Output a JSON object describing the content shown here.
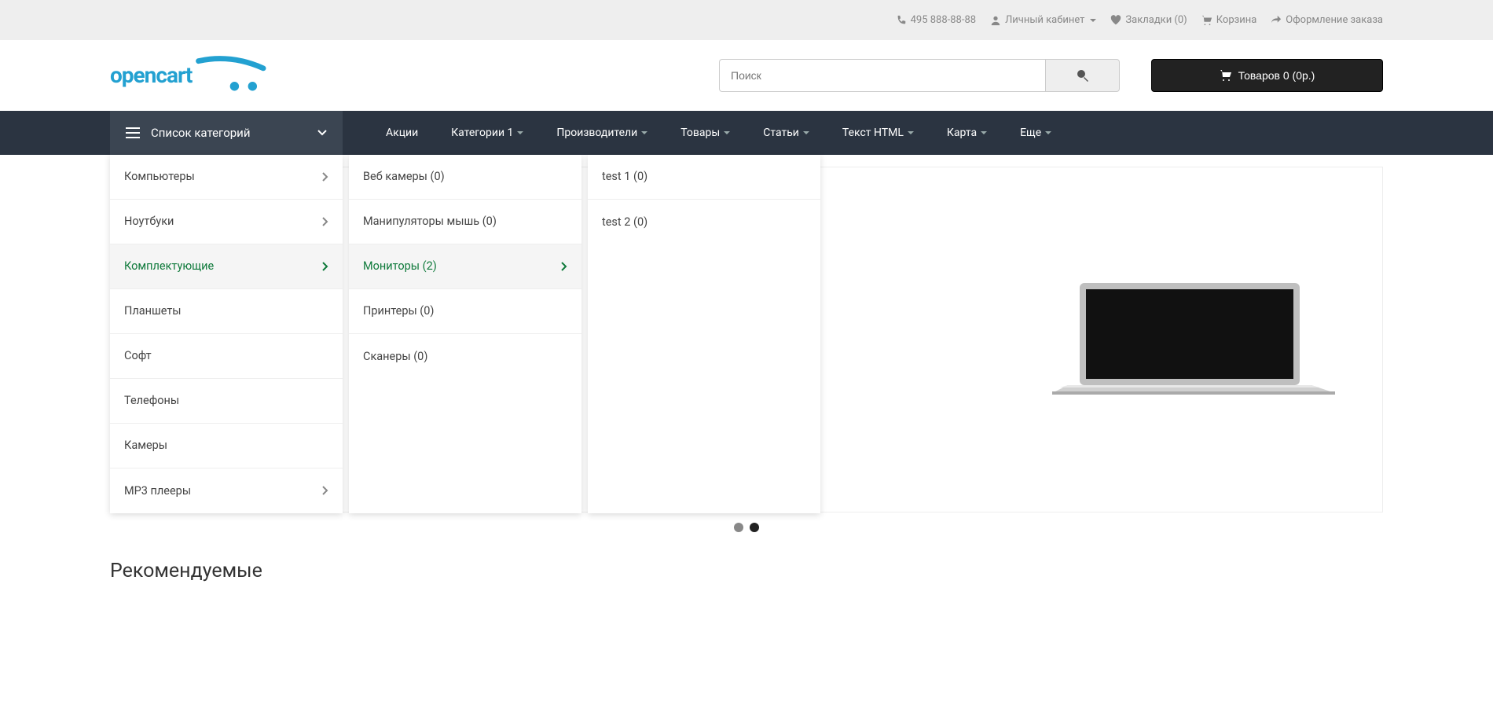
{
  "topbar": {
    "phone": "495 888-88-88",
    "account": "Личный кабинет",
    "wishlist": "Закладки (0)",
    "cart": "Корзина",
    "checkout": "Оформление заказа"
  },
  "logo": {
    "text": "opencart"
  },
  "search": {
    "placeholder": "Поиск"
  },
  "cart_button": {
    "label": "Товаров 0 (0р.)"
  },
  "catmenu": {
    "title": "Список категорий"
  },
  "nav": {
    "items": [
      "Акции",
      "Категории 1",
      "Производители",
      "Товары",
      "Статьи",
      "Текст HTML",
      "Карта",
      "Еще"
    ],
    "has_caret": [
      false,
      true,
      true,
      true,
      true,
      true,
      true,
      true
    ]
  },
  "menu_col1": [
    {
      "label": "Компьютеры",
      "arrow": true,
      "active": false
    },
    {
      "label": "Ноутбуки",
      "arrow": true,
      "active": false
    },
    {
      "label": "Комплектующие",
      "arrow": true,
      "active": true
    },
    {
      "label": "Планшеты",
      "arrow": false,
      "active": false
    },
    {
      "label": "Софт",
      "arrow": false,
      "active": false
    },
    {
      "label": "Телефоны",
      "arrow": false,
      "active": false
    },
    {
      "label": "Камеры",
      "arrow": false,
      "active": false
    },
    {
      "label": "MP3 плееры",
      "arrow": true,
      "active": false
    }
  ],
  "menu_col2": [
    {
      "label": "Веб камеры (0)",
      "arrow": false,
      "active": false
    },
    {
      "label": "Манипуляторы мышь (0)",
      "arrow": false,
      "active": false
    },
    {
      "label": "Мониторы (2)",
      "arrow": true,
      "active": true
    },
    {
      "label": "Принтеры (0)",
      "arrow": false,
      "active": false
    },
    {
      "label": "Сканеры (0)",
      "arrow": false,
      "active": false
    }
  ],
  "menu_col3": [
    {
      "label": "test 1 (0)",
      "arrow": false,
      "active": false
    },
    {
      "label": "test 2 (0)",
      "arrow": false,
      "active": false
    }
  ],
  "featured": {
    "title": "Рекомендуемые"
  }
}
